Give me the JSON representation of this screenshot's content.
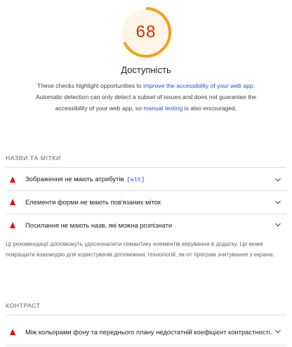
{
  "gauge": {
    "score": "68",
    "fraction": 0.68,
    "color": "#f4a01c"
  },
  "category": {
    "title": "Доступність",
    "desc_part1": "These checks highlight opportunities to ",
    "desc_link1": "improve the accessibility of your web app",
    "desc_part2": ". Automatic detection can only detect a subset of issues and does not guarantee the accessibility of your web app, so ",
    "desc_link2": "manual testing",
    "desc_part3": " is also encouraged."
  },
  "groups": [
    {
      "header": "Назви та мітки",
      "audits": [
        {
          "label": "Зображення не мають атрибутів",
          "code": "[alt]"
        },
        {
          "label": "Елементи форми не мають пов'язаних міток"
        },
        {
          "label": "Посилання не мають назв, які можна розпізнати"
        }
      ],
      "description": "Ці рекомендації допоможуть удосконалити семантику елементів керування в додатку. Це може покращити взаємодію для користувачів допоміжних технологій, як-от програм зчитування з екрана."
    },
    {
      "header": "Контраст",
      "audits": [
        {
          "label": "Між кольорами фону та переднього плану недостатній коефіцієнт контрастності."
        }
      ]
    }
  ],
  "colors": {
    "fail": "#eb0f00",
    "link": "#1a55c9",
    "score_text": "#c33300"
  },
  "icons": {
    "fail": "fail-triangle-icon",
    "expand": "chevron-down-icon"
  }
}
